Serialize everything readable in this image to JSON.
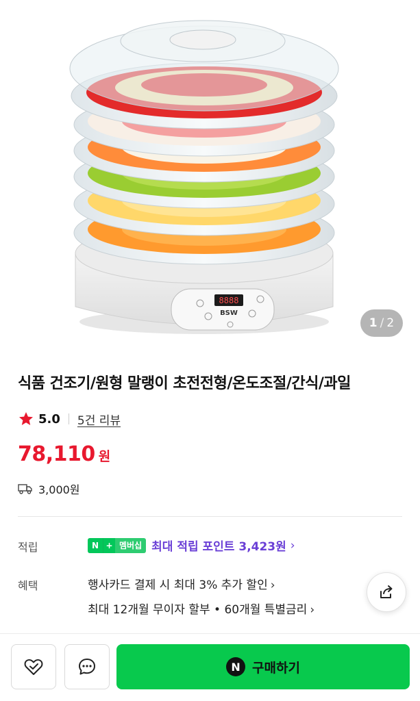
{
  "gallery": {
    "current": "1",
    "separator": "/",
    "total": "2",
    "product_logo_text": "BSW",
    "display_text": "8888"
  },
  "product": {
    "title": "식품 건조기/원형 말랭이 초전전형/온도조절/간식/과일"
  },
  "rating": {
    "score": "5.0",
    "review_link": "5건 리뷰",
    "star_color": "#e8182e"
  },
  "price": {
    "amount": "78,110",
    "unit": "원"
  },
  "shipping": {
    "fee": "3,000원",
    "icon": "truck-icon"
  },
  "points": {
    "label": "적립",
    "badge_n": "N",
    "badge_plus": "+",
    "badge_member": "멤버십",
    "text": "최대 적립 포인트 3,423원",
    "chevron": "›",
    "accent_color": "#6a3fd6"
  },
  "benefits": {
    "label": "혜택",
    "items": [
      "행사카드 결제 시 최대 3% 추가 할인",
      "최대 12개월 무이자 할부 • 60개월 특별금리"
    ],
    "chevron": "›"
  },
  "actions": {
    "share_icon": "share-icon",
    "wishlist_icon": "heart-check-icon",
    "chat_icon": "chat-bubble-icon",
    "buy_logo": "N",
    "buy_label": "구매하기",
    "buy_color": "#08c94d"
  }
}
